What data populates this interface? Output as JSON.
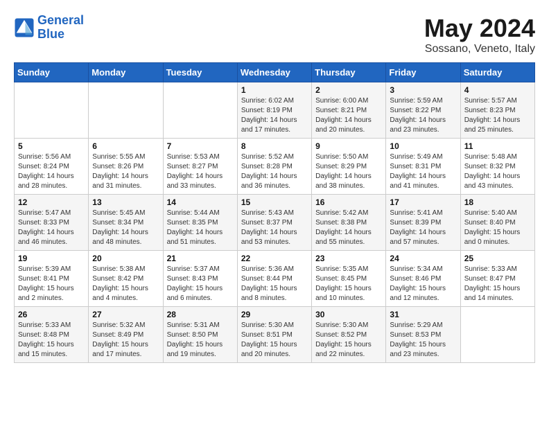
{
  "header": {
    "logo_line1": "General",
    "logo_line2": "Blue",
    "month": "May 2024",
    "location": "Sossano, Veneto, Italy"
  },
  "weekdays": [
    "Sunday",
    "Monday",
    "Tuesday",
    "Wednesday",
    "Thursday",
    "Friday",
    "Saturday"
  ],
  "weeks": [
    [
      {
        "day": "",
        "info": ""
      },
      {
        "day": "",
        "info": ""
      },
      {
        "day": "",
        "info": ""
      },
      {
        "day": "1",
        "info": "Sunrise: 6:02 AM\nSunset: 8:19 PM\nDaylight: 14 hours\nand 17 minutes."
      },
      {
        "day": "2",
        "info": "Sunrise: 6:00 AM\nSunset: 8:21 PM\nDaylight: 14 hours\nand 20 minutes."
      },
      {
        "day": "3",
        "info": "Sunrise: 5:59 AM\nSunset: 8:22 PM\nDaylight: 14 hours\nand 23 minutes."
      },
      {
        "day": "4",
        "info": "Sunrise: 5:57 AM\nSunset: 8:23 PM\nDaylight: 14 hours\nand 25 minutes."
      }
    ],
    [
      {
        "day": "5",
        "info": "Sunrise: 5:56 AM\nSunset: 8:24 PM\nDaylight: 14 hours\nand 28 minutes."
      },
      {
        "day": "6",
        "info": "Sunrise: 5:55 AM\nSunset: 8:26 PM\nDaylight: 14 hours\nand 31 minutes."
      },
      {
        "day": "7",
        "info": "Sunrise: 5:53 AM\nSunset: 8:27 PM\nDaylight: 14 hours\nand 33 minutes."
      },
      {
        "day": "8",
        "info": "Sunrise: 5:52 AM\nSunset: 8:28 PM\nDaylight: 14 hours\nand 36 minutes."
      },
      {
        "day": "9",
        "info": "Sunrise: 5:50 AM\nSunset: 8:29 PM\nDaylight: 14 hours\nand 38 minutes."
      },
      {
        "day": "10",
        "info": "Sunrise: 5:49 AM\nSunset: 8:31 PM\nDaylight: 14 hours\nand 41 minutes."
      },
      {
        "day": "11",
        "info": "Sunrise: 5:48 AM\nSunset: 8:32 PM\nDaylight: 14 hours\nand 43 minutes."
      }
    ],
    [
      {
        "day": "12",
        "info": "Sunrise: 5:47 AM\nSunset: 8:33 PM\nDaylight: 14 hours\nand 46 minutes."
      },
      {
        "day": "13",
        "info": "Sunrise: 5:45 AM\nSunset: 8:34 PM\nDaylight: 14 hours\nand 48 minutes."
      },
      {
        "day": "14",
        "info": "Sunrise: 5:44 AM\nSunset: 8:35 PM\nDaylight: 14 hours\nand 51 minutes."
      },
      {
        "day": "15",
        "info": "Sunrise: 5:43 AM\nSunset: 8:37 PM\nDaylight: 14 hours\nand 53 minutes."
      },
      {
        "day": "16",
        "info": "Sunrise: 5:42 AM\nSunset: 8:38 PM\nDaylight: 14 hours\nand 55 minutes."
      },
      {
        "day": "17",
        "info": "Sunrise: 5:41 AM\nSunset: 8:39 PM\nDaylight: 14 hours\nand 57 minutes."
      },
      {
        "day": "18",
        "info": "Sunrise: 5:40 AM\nSunset: 8:40 PM\nDaylight: 15 hours\nand 0 minutes."
      }
    ],
    [
      {
        "day": "19",
        "info": "Sunrise: 5:39 AM\nSunset: 8:41 PM\nDaylight: 15 hours\nand 2 minutes."
      },
      {
        "day": "20",
        "info": "Sunrise: 5:38 AM\nSunset: 8:42 PM\nDaylight: 15 hours\nand 4 minutes."
      },
      {
        "day": "21",
        "info": "Sunrise: 5:37 AM\nSunset: 8:43 PM\nDaylight: 15 hours\nand 6 minutes."
      },
      {
        "day": "22",
        "info": "Sunrise: 5:36 AM\nSunset: 8:44 PM\nDaylight: 15 hours\nand 8 minutes."
      },
      {
        "day": "23",
        "info": "Sunrise: 5:35 AM\nSunset: 8:45 PM\nDaylight: 15 hours\nand 10 minutes."
      },
      {
        "day": "24",
        "info": "Sunrise: 5:34 AM\nSunset: 8:46 PM\nDaylight: 15 hours\nand 12 minutes."
      },
      {
        "day": "25",
        "info": "Sunrise: 5:33 AM\nSunset: 8:47 PM\nDaylight: 15 hours\nand 14 minutes."
      }
    ],
    [
      {
        "day": "26",
        "info": "Sunrise: 5:33 AM\nSunset: 8:48 PM\nDaylight: 15 hours\nand 15 minutes."
      },
      {
        "day": "27",
        "info": "Sunrise: 5:32 AM\nSunset: 8:49 PM\nDaylight: 15 hours\nand 17 minutes."
      },
      {
        "day": "28",
        "info": "Sunrise: 5:31 AM\nSunset: 8:50 PM\nDaylight: 15 hours\nand 19 minutes."
      },
      {
        "day": "29",
        "info": "Sunrise: 5:30 AM\nSunset: 8:51 PM\nDaylight: 15 hours\nand 20 minutes."
      },
      {
        "day": "30",
        "info": "Sunrise: 5:30 AM\nSunset: 8:52 PM\nDaylight: 15 hours\nand 22 minutes."
      },
      {
        "day": "31",
        "info": "Sunrise: 5:29 AM\nSunset: 8:53 PM\nDaylight: 15 hours\nand 23 minutes."
      },
      {
        "day": "",
        "info": ""
      }
    ]
  ]
}
